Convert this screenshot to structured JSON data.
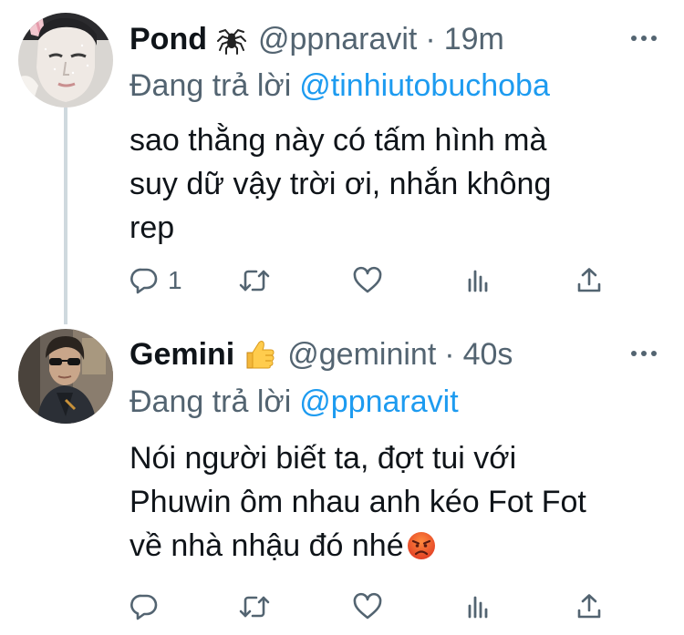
{
  "tweets": [
    {
      "display_name": "Pond",
      "name_emoji": "spider-icon",
      "handle": "@ppnaravit",
      "separator": "·",
      "time": "19m",
      "reply_prefix": "Đang trả lời",
      "reply_to": "@tinhiutobuchoba",
      "text_lines": [
        "sao thằng này có tấm hình mà",
        "suy dữ vậy trời ơi, nhắn không",
        "rep"
      ],
      "reply_count": "1"
    },
    {
      "display_name": "Gemini",
      "name_emoji": "thumbs-up-icon",
      "handle": "@geminint",
      "separator": "·",
      "time": "40s",
      "reply_prefix": "Đang trả lời",
      "reply_to": "@ppnaravit",
      "text_lines": [
        "Nói người biết ta, đợt tui với",
        "Phuwin ôm nhau anh kéo Fot Fot",
        "về nhà nhậu đó nhé"
      ],
      "text_emoji": "angry-face-icon"
    }
  ],
  "colors": {
    "text": "#0f1419",
    "secondary": "#536471",
    "link": "#1d9bf0",
    "thread_line": "#cfd9de"
  }
}
